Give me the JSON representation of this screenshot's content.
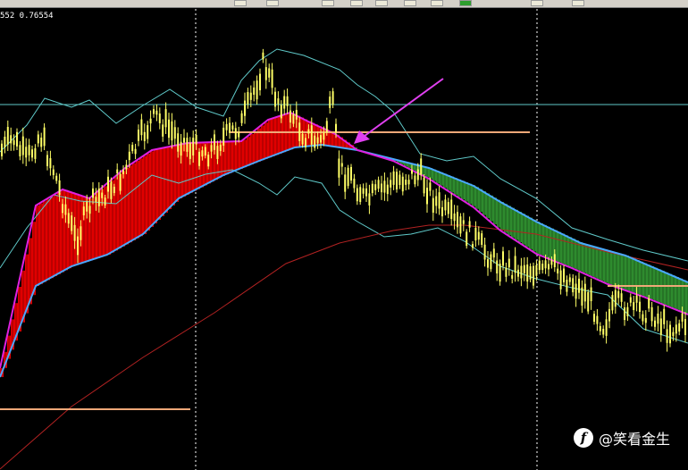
{
  "quote": {
    "text": "552 0.76554"
  },
  "watermark": {
    "handle": "@笑看金生",
    "logo_icon": "weibo-like-logo-icon"
  },
  "colors": {
    "background": "#000000",
    "candle": "#ffff66",
    "cloud_bull": "#2e8b2e",
    "cloud_bear": "#e00000",
    "fast_ma": "#e020e0",
    "slow_ma": "#4aa8ff",
    "long_ma": "#b22222",
    "bands": "#5fc9c9",
    "level_line": "#f0a878",
    "horizontal_ref": "#5fc9c9",
    "arrow": "#e040f0",
    "vgrid": "#ffffff"
  },
  "toolbar": {
    "icons": [
      "chart-icon",
      "chart-icon",
      "zoom-icon",
      "line-icon",
      "template-icon",
      "chart-icon",
      "chart-icon",
      "add-icon",
      "period-icon",
      "settings-icon"
    ]
  }
}
